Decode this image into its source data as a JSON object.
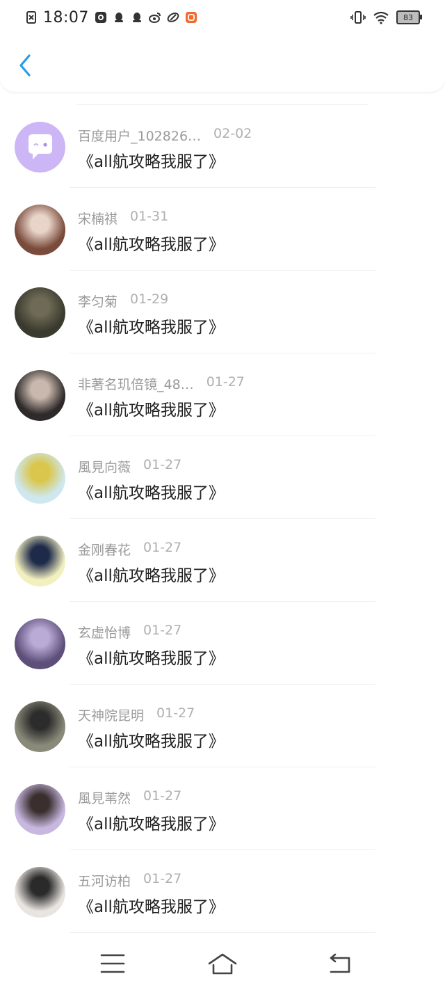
{
  "status_bar": {
    "time": "18:07",
    "battery": "83",
    "left_icons": [
      "sim-off-icon",
      "media-app-icon",
      "qq-icon",
      "qq-icon",
      "weibo-icon",
      "app-icon",
      "orange-app-icon"
    ],
    "right_icons": [
      "vibrate-icon",
      "wifi-icon",
      "battery-icon"
    ]
  },
  "header": {
    "back_icon": "chevron-left-icon",
    "accent": "#2b9ae8"
  },
  "items": [
    {
      "user": "百度用户_102826…",
      "date": "02-02",
      "title": "《all航攻略我服了》",
      "avatar_colors": [
        "#cdb6f5",
        "#ffffff"
      ]
    },
    {
      "user": "宋楠祺",
      "date": "01-31",
      "title": "《all航攻略我服了》",
      "avatar_colors": [
        "#7a4b3c",
        "#e8d4c8"
      ]
    },
    {
      "user": "李匀菊",
      "date": "01-29",
      "title": "《all航攻略我服了》",
      "avatar_colors": [
        "#3a3a2e",
        "#6e6a55"
      ]
    },
    {
      "user": "非著名玑倍镜_48…",
      "date": "01-27",
      "title": "《all航攻略我服了》",
      "avatar_colors": [
        "#2e2a2a",
        "#c9b8ad"
      ]
    },
    {
      "user": "風見向薇",
      "date": "01-27",
      "title": "《all航攻略我服了》",
      "avatar_colors": [
        "#cfe7ef",
        "#d9c64a"
      ]
    },
    {
      "user": "金刚春花",
      "date": "01-27",
      "title": "《all航攻略我服了》",
      "avatar_colors": [
        "#f3f0c0",
        "#1e2a4a"
      ]
    },
    {
      "user": "玄虚怡博",
      "date": "01-27",
      "title": "《all航攻略我服了》",
      "avatar_colors": [
        "#5e4f7a",
        "#b9abd6"
      ]
    },
    {
      "user": "天神院昆明",
      "date": "01-27",
      "title": "《all航攻略我服了》",
      "avatar_colors": [
        "#8a8a7a",
        "#2c2c2c"
      ]
    },
    {
      "user": "風見苇然",
      "date": "01-27",
      "title": "《all航攻略我服了》",
      "avatar_colors": [
        "#c8b8e0",
        "#3a2e2e"
      ]
    },
    {
      "user": "五河访柏",
      "date": "01-27",
      "title": "《all航攻略我服了》",
      "avatar_colors": [
        "#e8e4e0",
        "#2a2a2a"
      ]
    }
  ],
  "navbar": {
    "icons": [
      "menu-icon",
      "home-icon",
      "back-icon"
    ]
  }
}
